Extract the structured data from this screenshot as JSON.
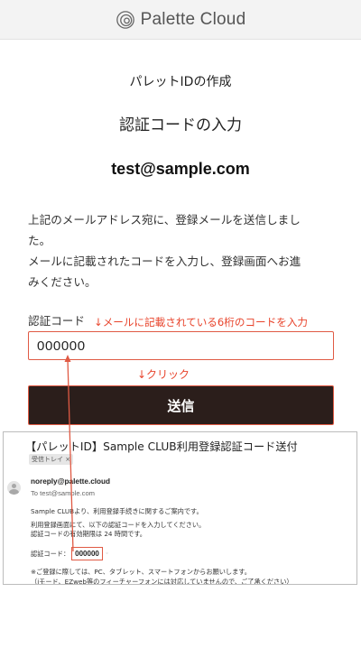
{
  "header": {
    "logo_text": "Palette Cloud"
  },
  "page": {
    "title": "パレットIDの作成",
    "subtitle": "認証コードの入力",
    "email": "test@sample.com",
    "description_lines": [
      "上記のメールアドレス宛に、登録メールを送信しまし",
      "た。",
      "メールに記載されたコードを入力し、登録画面へお進",
      "みください。"
    ]
  },
  "form": {
    "code_label": "認証コード",
    "code_value": "000000",
    "submit_label": "送信"
  },
  "annotations": {
    "input_hint": "↓メールに記載されている6桁のコードを入力",
    "click_hint": "↓クリック"
  },
  "email_preview": {
    "subject": "【パレットID】Sample CLUB利用登録認証コード送付",
    "tag": "受信トレイ ×",
    "from": "noreply@palette.cloud",
    "to": "To test@sample.com",
    "body_lines": [
      "Sample CLUBより、利用登録手続きに関するご案内です。",
      "利用登録画面にて、以下の認証コードを入力してください。",
      "認証コードの有効期限は 24 時間です。"
    ],
    "code_label": "認証コード：",
    "code": "000000",
    "footer_lines": [
      "※ご登録に際しては、PC、タブレット、スマートフォンからお願いします。",
      "（iモード、EZweb等のフィーチャーフォンには対応していませんので、ご了承ください）"
    ]
  },
  "colors": {
    "accent": "#e8442c",
    "button_bg": "#2b1e1b",
    "header_bg": "#f3f3f3"
  }
}
